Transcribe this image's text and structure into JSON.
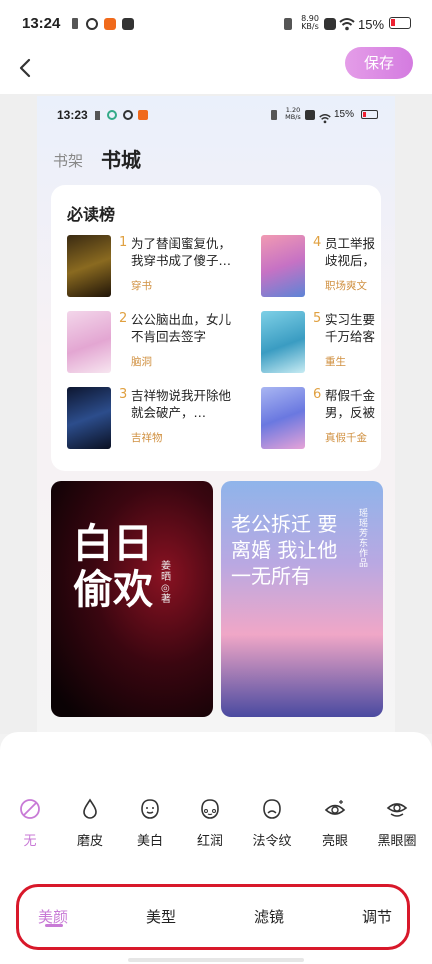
{
  "outer_status": {
    "time": "13:24",
    "net_speed": "8.90 KB/s",
    "battery": "15%"
  },
  "topbar": {
    "save_label": "保存"
  },
  "preview": {
    "status": {
      "time": "13:23",
      "net_speed": "1.20 MB/s",
      "battery": "15%"
    },
    "tabs": {
      "shelf": "书架",
      "store": "书城"
    },
    "rank": {
      "title": "必读榜",
      "books": [
        {
          "num": "1",
          "title": "为了替闺蜜复仇，我穿书成了傻子…",
          "tag": "穿书"
        },
        {
          "num": "2",
          "title": "公公脑出血，女儿不肯回去签字",
          "tag": "脑洞"
        },
        {
          "num": "3",
          "title": "吉祥物说我开除他就会破产，…",
          "tag": "吉祥物"
        },
        {
          "num": "4",
          "title": "员工举报歧视后，",
          "tag": "职场爽文"
        },
        {
          "num": "5",
          "title": "实习生要千万给客",
          "tag": "重生"
        },
        {
          "num": "6",
          "title": "帮假千金男，反被",
          "tag": "真假千金"
        }
      ]
    },
    "covers": {
      "left_text": "白日偷欢",
      "left_author": "姜晒◎著",
      "right_text": "老公拆迁 要离婚 我让他 一无所有",
      "right_author": "瑶瑶芳东 作品"
    }
  },
  "tools": [
    {
      "label": "无",
      "icon": "none-icon"
    },
    {
      "label": "磨皮",
      "icon": "drop-icon"
    },
    {
      "label": "美白",
      "icon": "face-smile-icon"
    },
    {
      "label": "红润",
      "icon": "face-blush-icon"
    },
    {
      "label": "法令纹",
      "icon": "face-lines-icon"
    },
    {
      "label": "亮眼",
      "icon": "eye-sparkle-icon"
    },
    {
      "label": "黑眼圈",
      "icon": "eye-circle-icon"
    }
  ],
  "bottom_tabs": [
    {
      "label": "美颜"
    },
    {
      "label": "美型"
    },
    {
      "label": "滤镜"
    },
    {
      "label": "调节"
    }
  ],
  "colors": {
    "accent": "#c87ad6",
    "highlight_frame": "#d8182a",
    "rank_number": "#e0a040"
  }
}
